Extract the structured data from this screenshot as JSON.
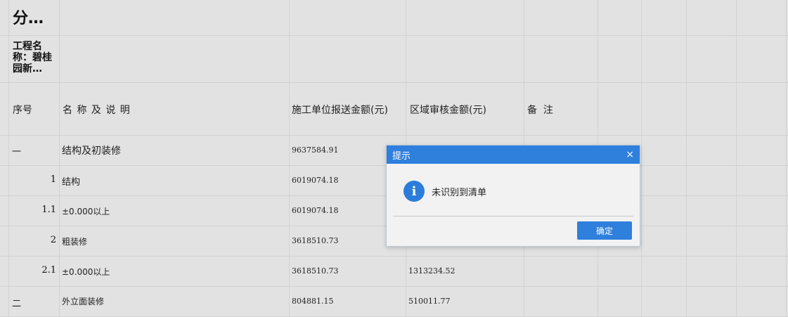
{
  "sheet": {
    "title": "分…",
    "project_label": "工程名称：碧桂园新…",
    "headers": {
      "seq": "序号",
      "name": "名 称 及 说 明",
      "submitted": "施工单位报送金额(元)",
      "audited": "区域审核金额(元)",
      "remark": "备  注"
    },
    "rows": [
      {
        "seq": "一",
        "name": "结构及初装修",
        "submitted": "9637584.91",
        "audited": ""
      },
      {
        "seq": "1",
        "name": "结构",
        "submitted": "6019074.18",
        "audited": ""
      },
      {
        "seq": "1.1",
        "name": "±0.000以上",
        "submitted": "6019074.18",
        "audited": ""
      },
      {
        "seq": "2",
        "name": "粗装修",
        "submitted": "3618510.73",
        "audited": ""
      },
      {
        "seq": "2.1",
        "name": "±0.000以上",
        "submitted": "3618510.73",
        "audited": "1313234.52"
      },
      {
        "seq": "二",
        "name": "外立面装修",
        "submitted": "804881.15",
        "audited": "510011.77"
      }
    ]
  },
  "dialog": {
    "title": "提示",
    "close_glyph": "×",
    "icon": "info-icon",
    "message": "未识别到清单",
    "ok_label": "确定",
    "accent_color": "#2f7fdc"
  }
}
